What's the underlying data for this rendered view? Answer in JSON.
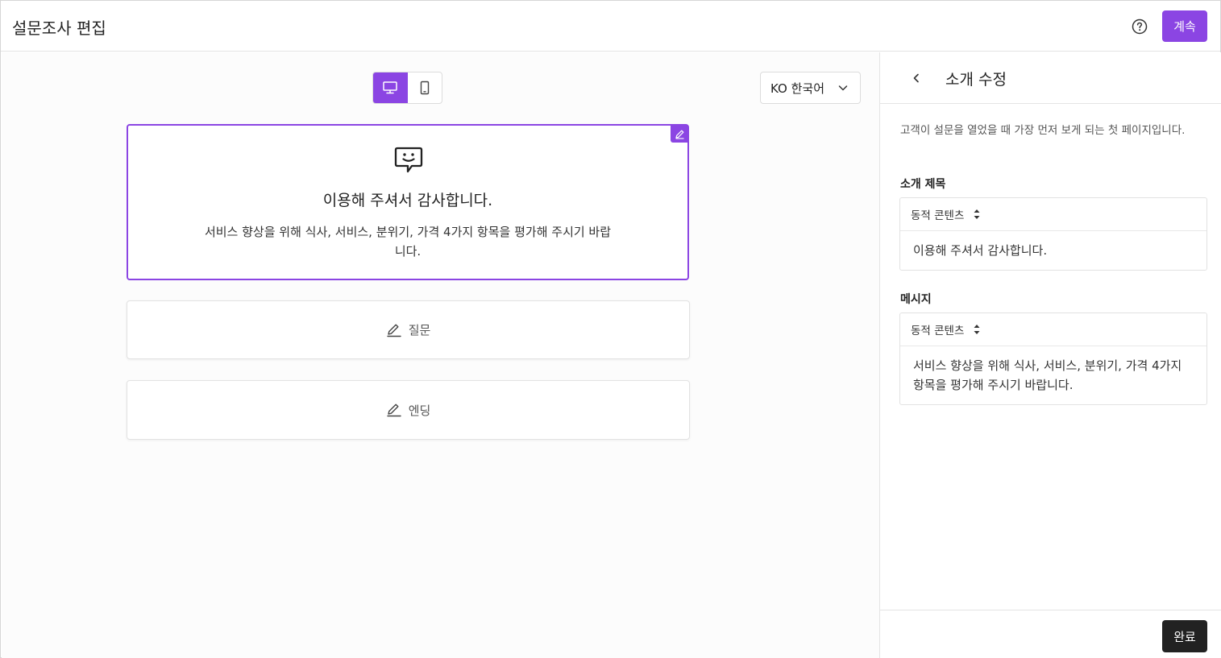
{
  "header": {
    "title": "설문조사 편집",
    "help_icon": "question-circle-icon",
    "continue_label": "계속"
  },
  "canvas": {
    "device_modes": [
      "desktop",
      "mobile"
    ],
    "active_device": "desktop",
    "language": "KO 한국어",
    "intro": {
      "icon": "chat-smile-icon",
      "title": "이용해 주셔서 감사합니다.",
      "message": "서비스 향상을 위해 식사, 서비스, 분위기, 가격 4가지 항목을 평가해 주시기 바랍니다."
    },
    "sections": [
      {
        "label": "질문",
        "icon": "pencil-icon"
      },
      {
        "label": "엔딩",
        "icon": "pencil-icon"
      }
    ]
  },
  "panel": {
    "title": "소개 수정",
    "description": "고객이 설문을 열었을 때 가장 먼저 보게 되는 첫 페이지입니다.",
    "title_field": {
      "label": "소개 제목",
      "dynamic_label": "동적 콘텐츠",
      "value": "이용해 주셔서 감사합니다."
    },
    "message_field": {
      "label": "메시지",
      "dynamic_label": "동적 콘텐츠",
      "value": "서비스 향상을 위해 식사, 서비스, 분위기, 가격 4가지 항목을 평가해 주시기 바랍니다."
    },
    "done_label": "완료"
  },
  "colors": {
    "accent": "#8b45e3",
    "dark_button": "#222222"
  }
}
